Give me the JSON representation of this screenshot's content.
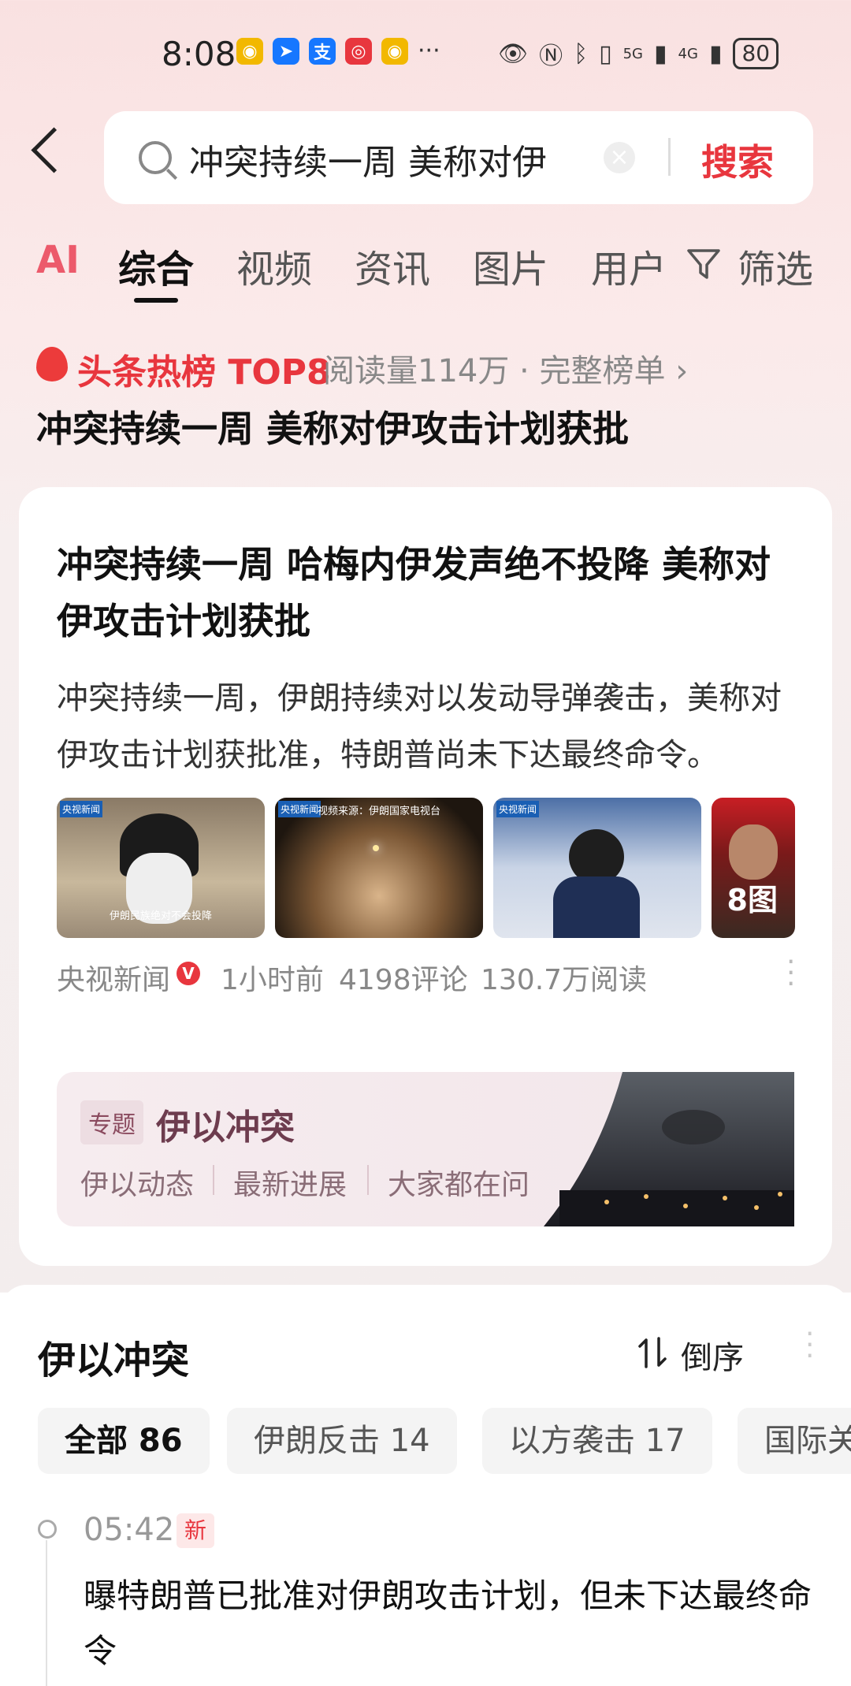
{
  "status_bar": {
    "time": "8:08",
    "app_icons": [
      "weibo-icon",
      "map-icon",
      "alipay-icon",
      "app-icon",
      "weibo-icon"
    ],
    "more": "···",
    "signal1": "5G",
    "signal2": "4G",
    "battery": "80"
  },
  "search": {
    "query": "冲突持续一周 美称对伊",
    "button": "搜索"
  },
  "tabs": {
    "ai": "AI",
    "items": [
      "综合",
      "视频",
      "资讯",
      "图片",
      "用户"
    ],
    "filter": "筛选",
    "active_index": 0
  },
  "hot": {
    "label": "头条热榜 TOP8",
    "meta": "阅读量114万 · 完整榜单 ›",
    "title": "冲突持续一周 美称对伊攻击计划获批"
  },
  "article": {
    "title": "冲突持续一周 哈梅内伊发声绝不投降 美称对伊攻击计划获批",
    "summary": "冲突持续一周，伊朗持续对以发动导弹袭击，美称对伊攻击计划获批准，特朗普尚未下达最终命令。",
    "thumb_badge": "央视新闻",
    "thumb_caption_1": "伊朗民族绝对不会投降",
    "thumb_caption_2": "视频来源：伊朗国家电视台",
    "image_count": "8图",
    "source": "央视新闻",
    "verified": "V",
    "time": "1小时前",
    "comments": "4198评论",
    "reads": "130.7万阅读"
  },
  "topic": {
    "tag": "专题",
    "title": "伊以冲突",
    "links": [
      "伊以动态",
      "最新进展",
      "大家都在问"
    ]
  },
  "section": {
    "title": "伊以冲突",
    "sort_label": "倒序",
    "chips": [
      "全部 86",
      "伊朗反击 14",
      "以方袭击 17",
      "国际关"
    ],
    "timeline": {
      "time": "05:42",
      "badge": "新",
      "text": "曝特朗普已批准对伊朗攻击计划，但未下达最终命令"
    }
  },
  "colors": {
    "accent": "#e8363e",
    "topic_title": "#6d3c4e"
  }
}
